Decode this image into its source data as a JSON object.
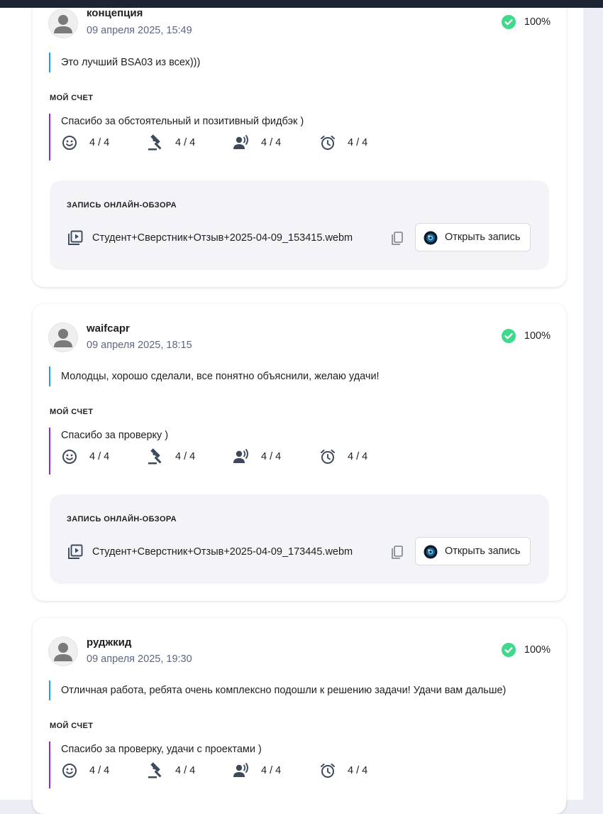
{
  "colors": {
    "accent_quote": "#2196f3",
    "accent_mine": "#8c2ad8",
    "check_green": "#3fd98b",
    "date_text": "#5c6680",
    "top_bar": "#1c2331"
  },
  "icons": {
    "avatar": "user-avatar-icon",
    "check": "check-circle-icon",
    "ratings": [
      "smile-icon",
      "gavel-icon",
      "voice-icon",
      "alarm-clock-icon"
    ],
    "video": "video-library-icon",
    "copy": "copy-icon",
    "camera": "camera-lens-icon"
  },
  "labels": {
    "my_score": "МОЙ СЧЕТ",
    "recording_title": "ЗАПИСЬ ОНЛАЙН-ОБЗОРА",
    "open_record": "Открыть запись"
  },
  "reviews": [
    {
      "username": "концепция",
      "date": "09 апреля 2025, 15:49",
      "score": "100%",
      "comment": "Это лучший BSA03 из всех)))",
      "my_comment": "Спасибо за обстоятельный и позитивный фидбэк )",
      "ratings": [
        "4 / 4",
        "4 / 4",
        "4 / 4",
        "4 / 4"
      ],
      "recording_file": "Студент+Сверстник+Отзыв+2025-04-09_153415.webm"
    },
    {
      "username": "waifcapr",
      "date": "09 апреля 2025, 18:15",
      "score": "100%",
      "comment": "Молодцы, хорошо сделали, все понятно объяснили, желаю удачи!",
      "my_comment": "Спасибо за проверку )",
      "ratings": [
        "4 / 4",
        "4 / 4",
        "4 / 4",
        "4 / 4"
      ],
      "recording_file": "Студент+Сверстник+Отзыв+2025-04-09_173445.webm"
    },
    {
      "username": "руджкид",
      "date": "09 апреля 2025, 19:30",
      "score": "100%",
      "comment": "Отличная работа, ребята очень комплексно подошли к решению задачи! Удачи вам дальше)",
      "my_comment": "Спасибо за проверку, удачи с проектами )",
      "ratings": [
        "4 / 4",
        "4 / 4",
        "4 / 4",
        "4 / 4"
      ]
    }
  ]
}
